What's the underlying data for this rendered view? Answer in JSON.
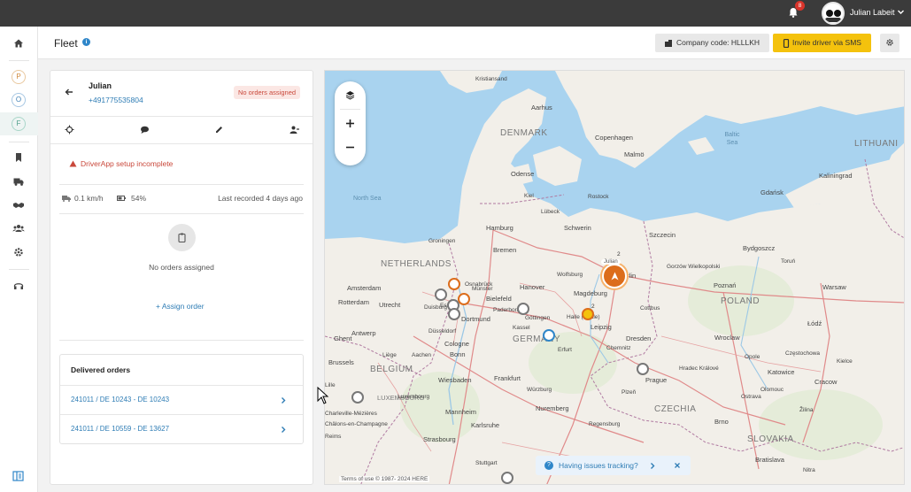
{
  "topbar": {
    "notification_count": "8",
    "user_name": "Julian Labeit"
  },
  "nav": {
    "letters": [
      "P",
      "O",
      "F"
    ],
    "icons": [
      "home-icon",
      "bookmark-icon",
      "truck-icon",
      "handshake-icon",
      "team-icon",
      "gear-icon",
      "headset-icon",
      "sidebar-toggle-icon"
    ]
  },
  "header": {
    "title": "Fleet",
    "company_code": "Company code: HLLLKH",
    "invite_label": "Invite driver via SMS"
  },
  "driver": {
    "name": "Julian",
    "phone": "+491775535804",
    "status_badge": "No orders assigned",
    "warning": "DriverApp setup incomplete",
    "speed": "0.1 km/h",
    "battery": "54%",
    "last_recorded": "Last recorded 4 days ago",
    "empty_text": "No orders assigned",
    "assign_label": "Assign order"
  },
  "delivered": {
    "title": "Delivered orders",
    "orders": [
      "241011 / DE 10243 - DE 10243",
      "241011 / DE 10559 - DE 13627"
    ]
  },
  "map": {
    "countries": [
      "DENMARK",
      "NETHERLANDS",
      "GERMANY",
      "POLAND",
      "BELGIUM",
      "LUXEMBOURG",
      "CZECHIA",
      "SLOVAKIA",
      "LITHUANI"
    ],
    "seas": [
      "North Sea",
      "Baltic Sea"
    ],
    "cities": {
      "aarhus": "Aarhus",
      "copenhagen": "Copenhagen",
      "malmo": "Malmö",
      "odense": "Odense",
      "hamburg": "Hamburg",
      "bremen": "Bremen",
      "schwerin": "Schwerin",
      "szczecin": "Szczecin",
      "gdansk": "Gdańsk",
      "kaliningrad": "Kaliningrad",
      "bydgoszcz": "Bydgoszcz",
      "amsterdam": "Amsterdam",
      "rotterdam": "Rotterdam",
      "utrecht": "Utrecht",
      "hanover": "Hanover",
      "berlin": "erlin",
      "magdeburg": "Magdeburg",
      "poznan": "Poznań",
      "warsaw": "Warsaw",
      "bielefeld": "Bielefeld",
      "dortmund": "Dortmund",
      "cologne": "Cologne",
      "leipzig": "Leipzig",
      "dresden": "Dresden",
      "wroclaw": "Wroclaw",
      "lodz": "Łódź",
      "bonn": "Bonn",
      "frankfurt": "Frankfurt",
      "wiesbaden": "Wiesbaden",
      "prague": "Prague",
      "brussels": "Brussels",
      "antwerp": "Antwerp",
      "ghent": "Ghent",
      "nuremberg": "Nuremberg",
      "mannheim": "Mannheim",
      "karlsruhe": "Karlsruhe",
      "strasbourg": "Strasbourg",
      "katowice": "Katowice",
      "krakow": "Cracow",
      "brno": "Brno",
      "bratislava": "Bratislava",
      "kassel": "Kassel",
      "gottingen": "Göttingen",
      "chemnitz": "Chemnitz",
      "halle": "Halle (Saale)",
      "erfurt": "Erfurt",
      "kiel": "Kiel",
      "lubeck": "Lübeck",
      "rostock": "Rostock",
      "groningen": "Groningen",
      "osnabruck": "Osnabrück",
      "lille": "Lille",
      "luxembourg_city": "Luxembourg",
      "olomouc": "Olomouc",
      "ostrava": "Ostrava",
      "plzen": "Plzeň",
      "kielce": "Kielce",
      "torun": "Toruń",
      "stuttgart": "Stuttgart",
      "wurzburg": "Würzburg",
      "regensburg": "Regensburg",
      "zilina": "Žilina",
      "nitra": "Nitra",
      "reims": "Reims",
      "charleville": "Charleville-Mézières",
      "chalons": "Châlons-en-Champagne",
      "liege": "Liège",
      "aachen": "Aachen",
      "duisburg": "Duisburg",
      "dusseldorf": "Düsseldorf",
      "essen": "Essen",
      "munster": "Münster",
      "paderborn": "Paderborn",
      "wolfsburg": "Wolfsburg",
      "cottbus": "Cottbus",
      "gorzow": "Gorzów Wielkopolski",
      "czestochowa": "Częstochowa",
      "opole": "Opole",
      "hradec": "Hradec Králové",
      "kristiansand": "Kristiansand"
    },
    "cluster_label": "Julian",
    "cluster_count": "2",
    "small_cluster_count": "2",
    "banner_text": "Having issues tracking?",
    "attribution": "Terms of use    © 1987- 2024 HERE"
  }
}
